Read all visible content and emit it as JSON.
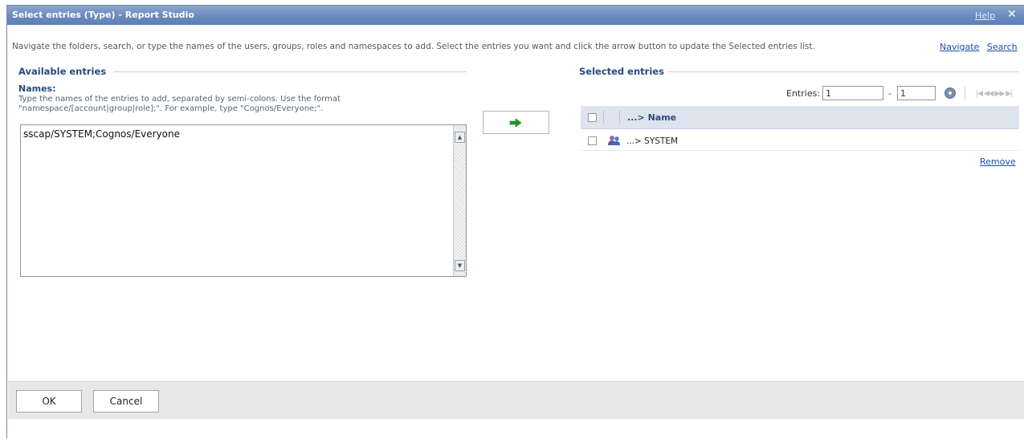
{
  "window": {
    "title": "Select entries (Type) - Report Studio",
    "help_label": "Help",
    "close_glyph": "✕"
  },
  "instructions": "Navigate the folders, search, or type the names of the users, groups, roles and namespaces to add. Select the entries you want and click the arrow button to update the Selected entries list.",
  "links": {
    "navigate": "Navigate",
    "search": "Search"
  },
  "available": {
    "heading": "Available entries",
    "names_label": "Names:",
    "help_text": "Type the names of the entries to add, separated by semi-colons. Use the format \"namespace/[account|group|role];\". For example, type \"Cognos/Everyone;\".",
    "value": "sscap/SYSTEM;Cognos/Everyone"
  },
  "add_button": {
    "icon": "green-arrow-right-icon",
    "color": "#1f9d1f"
  },
  "selected": {
    "heading": "Selected entries",
    "pager": {
      "label": "Entries:",
      "from": "1",
      "dash": "-",
      "to": "1"
    },
    "columns": {
      "name": "...> Name"
    },
    "rows": [
      {
        "prefix": "...>",
        "name": "SYSTEM",
        "icon": "user-group-icon"
      }
    ],
    "remove_label": "Remove"
  },
  "footer": {
    "ok_label": "OK",
    "cancel_label": "Cancel"
  }
}
